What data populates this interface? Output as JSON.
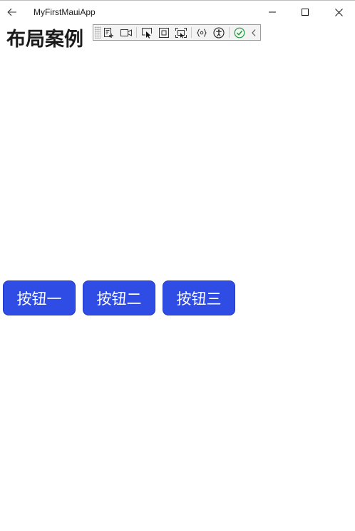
{
  "window": {
    "title": "MyFirstMauiApp"
  },
  "page": {
    "heading": "布局案例"
  },
  "buttons": [
    {
      "label": "按钮一"
    },
    {
      "label": "按钮二"
    },
    {
      "label": "按钮三"
    }
  ],
  "colors": {
    "button_background": "#2f4ce4",
    "button_text": "#ffffff",
    "heading_text": "#1b1b1b",
    "hot_reload_ok": "#1e9c3c"
  },
  "debug_toolbar": {
    "icons": [
      "live-visual-tree-icon",
      "record-icon",
      "select-element-icon",
      "display-layout-adorners-icon",
      "track-focus-icon",
      "binding-failures-icon",
      "accessibility-checker-icon",
      "hot-reload-status-icon",
      "collapse-toolbar-icon"
    ]
  }
}
